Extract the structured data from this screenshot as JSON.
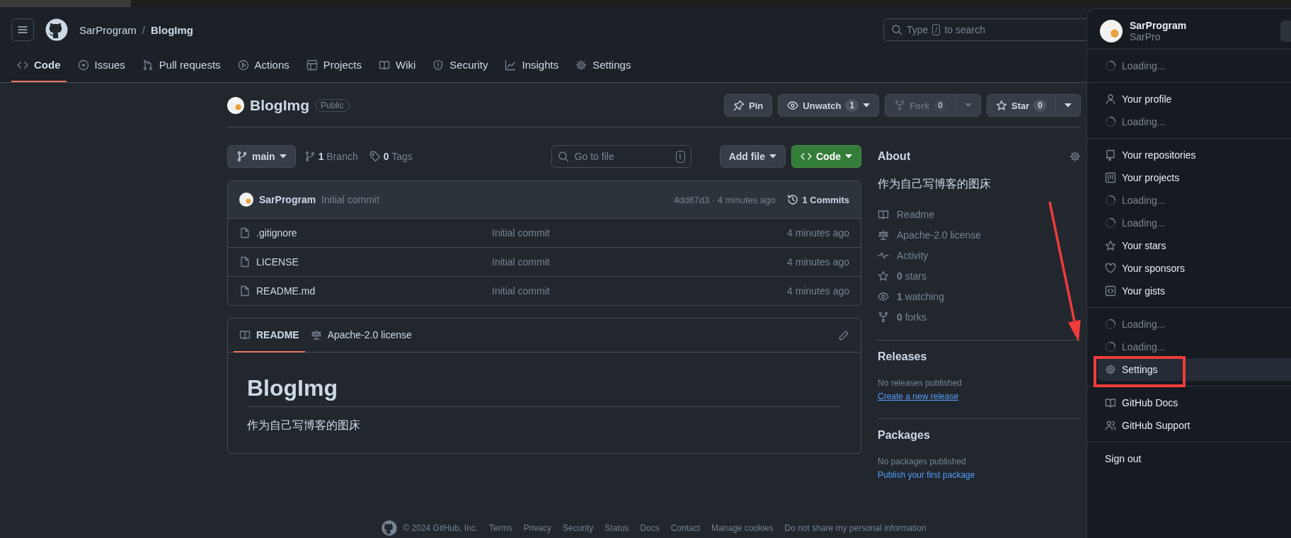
{
  "header": {
    "owner": "SarProgram",
    "separator": "/",
    "repo": "BlogImg",
    "search_before": "Type",
    "search_key": "/",
    "search_after": "to search"
  },
  "nav_tabs": [
    {
      "label": "Code",
      "selected": true
    },
    {
      "label": "Issues",
      "selected": false
    },
    {
      "label": "Pull requests",
      "selected": false
    },
    {
      "label": "Actions",
      "selected": false
    },
    {
      "label": "Projects",
      "selected": false
    },
    {
      "label": "Wiki",
      "selected": false
    },
    {
      "label": "Security",
      "selected": false
    },
    {
      "label": "Insights",
      "selected": false
    },
    {
      "label": "Settings",
      "selected": false
    }
  ],
  "repo": {
    "name": "BlogImg",
    "visibility": "Public",
    "actions": [
      {
        "label": "Pin",
        "disabled": false,
        "dropdown": false
      },
      {
        "label": "Unwatch",
        "count": "1",
        "disabled": false,
        "dropdown": false,
        "caret": true
      },
      {
        "label": "Fork",
        "count": "0",
        "disabled": true,
        "dropdown": true
      },
      {
        "label": "Star",
        "count": "0",
        "disabled": false,
        "dropdown": true
      }
    ]
  },
  "toolbar": {
    "branch": "main",
    "branches": "**1** Branch",
    "tags": "**0** Tags",
    "file_search_placeholder": "Go to file",
    "file_search_key": "t",
    "add_file": "Add file",
    "code": "Code"
  },
  "latest_commit": {
    "author": "SarProgram",
    "message": "Initial commit",
    "hash_time": "4dd67d3 · 4 minutes ago",
    "commits": "1 Commits"
  },
  "files": [
    {
      "name": ".gitignore",
      "message": "Initial commit",
      "time": "4 minutes ago"
    },
    {
      "name": "LICENSE",
      "message": "Initial commit",
      "time": "4 minutes ago"
    },
    {
      "name": "README.md",
      "message": "Initial commit",
      "time": "4 minutes ago"
    }
  ],
  "readme": {
    "tabs": [
      {
        "label": "README",
        "selected": true
      },
      {
        "label": "Apache-2.0 license",
        "selected": false
      }
    ],
    "heading": "BlogImg",
    "body": "作为自己写博客的图床"
  },
  "about": {
    "title": "About",
    "description": "作为自己写博客的图床",
    "items": [
      "Readme",
      "Apache-2.0 license",
      "Activity",
      "**0** stars",
      "**1** watching",
      "**0** forks"
    ]
  },
  "releases": {
    "title": "Releases",
    "note": "No releases published",
    "link": "Create a new release"
  },
  "packages": {
    "title": "Packages",
    "note": "No packages published",
    "link": "Publish your first package"
  },
  "footer": {
    "copyright": "© 2024 GitHub, Inc.",
    "links": [
      "Terms",
      "Privacy",
      "Security",
      "Status",
      "Docs",
      "Contact",
      "Manage cookies",
      "Do not share my personal information"
    ]
  },
  "user_menu": {
    "name": "SarProgram",
    "handle": "SarPro",
    "groups": [
      {
        "items": [
          {
            "kind": "loading",
            "label": "Loading...",
            "highlighted": false
          }
        ]
      },
      {
        "items": [
          {
            "kind": "link",
            "label": "Your profile",
            "highlighted": false
          },
          {
            "kind": "loading",
            "label": "Loading...",
            "highlighted": false
          }
        ]
      },
      {
        "items": [
          {
            "kind": "link",
            "label": "Your repositories",
            "highlighted": false
          },
          {
            "kind": "link",
            "label": "Your projects",
            "highlighted": false
          },
          {
            "kind": "loading",
            "label": "Loading...",
            "highlighted": false
          },
          {
            "kind": "loading",
            "label": "Loading...",
            "highlighted": false
          },
          {
            "kind": "link",
            "label": "Your stars",
            "highlighted": false
          },
          {
            "kind": "link",
            "label": "Your sponsors",
            "highlighted": false
          },
          {
            "kind": "link",
            "label": "Your gists",
            "highlighted": false
          }
        ]
      },
      {
        "items": [
          {
            "kind": "loading",
            "label": "Loading...",
            "highlighted": false
          },
          {
            "kind": "loading",
            "label": "Loading...",
            "highlighted": false
          },
          {
            "kind": "link",
            "label": "Settings",
            "highlighted": true
          }
        ]
      },
      {
        "items": [
          {
            "kind": "link",
            "label": "GitHub Docs",
            "highlighted": false
          },
          {
            "kind": "link",
            "label": "GitHub Support",
            "highlighted": false
          }
        ]
      },
      {
        "items": [
          {
            "kind": "plain",
            "label": "Sign out",
            "highlighted": false
          }
        ]
      }
    ]
  }
}
